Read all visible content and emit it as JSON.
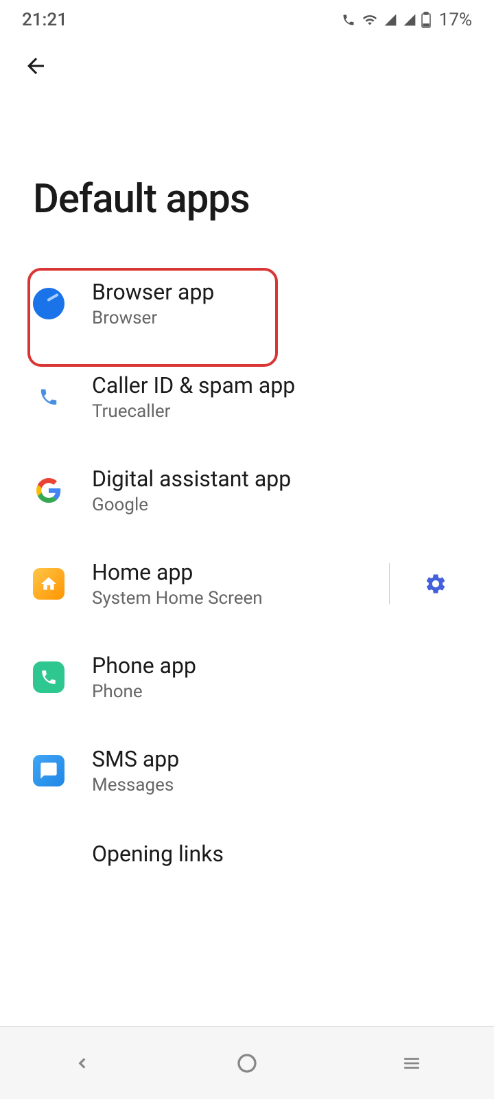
{
  "status_bar": {
    "time": "21:21",
    "battery_percent": "17%"
  },
  "page": {
    "title": "Default apps"
  },
  "items": [
    {
      "title": "Browser app",
      "subtitle": "Browser",
      "icon": "browser",
      "highlighted": true
    },
    {
      "title": "Caller ID & spam app",
      "subtitle": "Truecaller",
      "icon": "phone-blue"
    },
    {
      "title": "Digital assistant app",
      "subtitle": "Google",
      "icon": "google"
    },
    {
      "title": "Home app",
      "subtitle": "System Home Screen",
      "icon": "home",
      "has_settings": true
    },
    {
      "title": "Phone app",
      "subtitle": "Phone",
      "icon": "phone-green"
    },
    {
      "title": "SMS app",
      "subtitle": "Messages",
      "icon": "sms"
    },
    {
      "title": "Opening links",
      "subtitle": "",
      "icon": ""
    }
  ]
}
